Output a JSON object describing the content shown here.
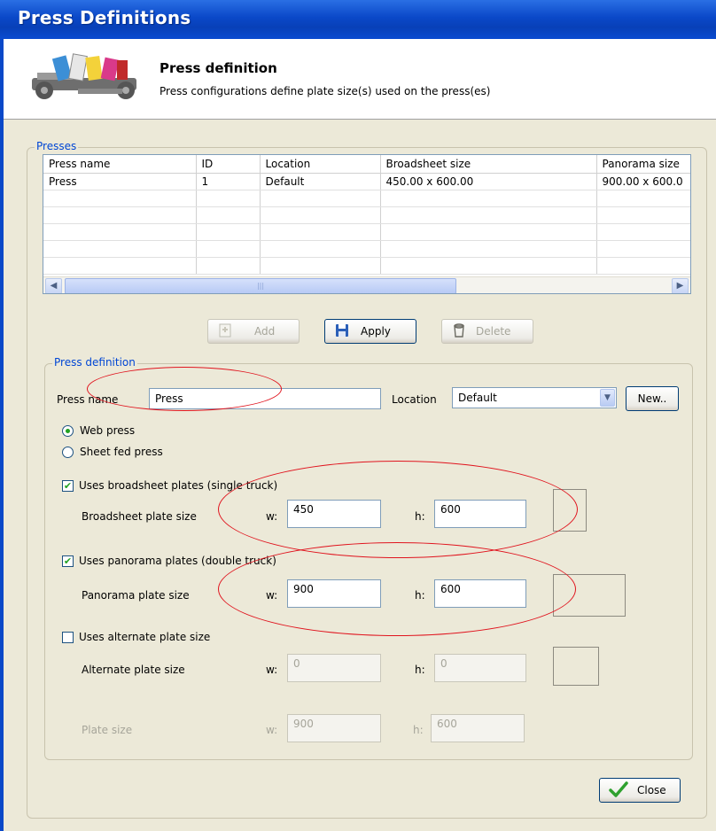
{
  "window": {
    "title": "Press Definitions"
  },
  "header": {
    "icon": "press-machine-icon",
    "title": "Press definition",
    "subtitle": "Press configurations define plate size(s) used on the press(es)"
  },
  "presses": {
    "legend": "Presses",
    "columns": [
      "Press name",
      "ID",
      "Location",
      "Broadsheet size",
      "Panorama size"
    ],
    "rows": [
      [
        "Press",
        "1",
        "Default",
        "450.00 x 600.00",
        "900.00 x 600.0"
      ]
    ]
  },
  "actions": {
    "add": "Add",
    "apply": "Apply",
    "delete": "Delete"
  },
  "definition": {
    "legend": "Press definition",
    "press_name_label": "Press name",
    "press_name_value": "Press",
    "location_label": "Location",
    "location_value": "Default",
    "new_button": "New..",
    "web_press": "Web press",
    "sheet_fed_press": "Sheet fed press",
    "broadsheet": {
      "checkbox": "Uses broadsheet plates (single truck)",
      "label": "Broadsheet plate size",
      "w_label": "w:",
      "w": "450",
      "h_label": "h:",
      "h": "600"
    },
    "panorama": {
      "checkbox": "Uses panorama plates (double truck)",
      "label": "Panorama plate size",
      "w_label": "w:",
      "w": "900",
      "h_label": "h:",
      "h": "600"
    },
    "alternate": {
      "checkbox": "Uses alternate plate size",
      "label": "Alternate plate size",
      "w_label": "w:",
      "w": "0",
      "h_label": "h:",
      "h": "0"
    },
    "plate": {
      "label": "Plate size",
      "w_label": "w:",
      "w": "900",
      "h_label": "h:",
      "h": "600"
    }
  },
  "footer": {
    "close": "Close"
  },
  "colors": {
    "title_bar": "#0a48c8",
    "annotation": "#e0141e",
    "group_legend": "#0046d5"
  }
}
